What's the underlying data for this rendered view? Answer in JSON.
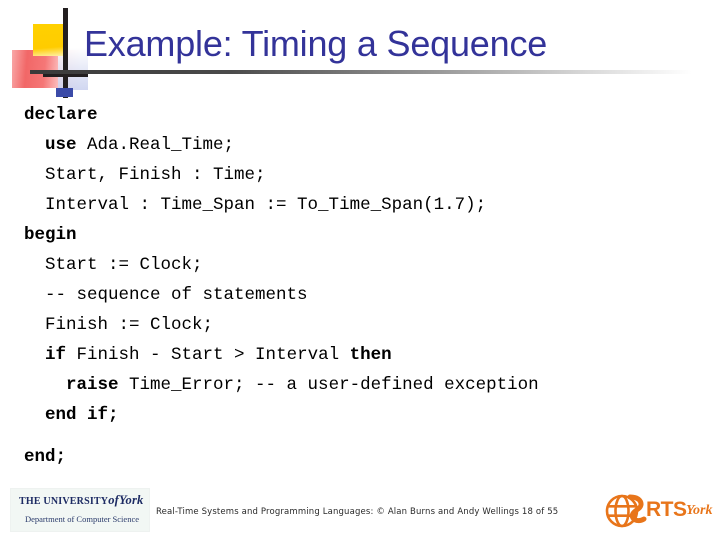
{
  "slide": {
    "title": "Example: Timing a Sequence",
    "title_color": "#333399",
    "background_color": "#ffffff"
  },
  "decoration": {
    "yellow_color": "#FFCC00",
    "red_color": "#F05A5A",
    "blue_color": "#3B4BA8",
    "bar_color": "#231F20"
  },
  "code": {
    "language": "Ada",
    "lines": [
      {
        "indent": 0,
        "spans": [
          {
            "text": "declare",
            "bold": true
          }
        ]
      },
      {
        "indent": 2,
        "spans": [
          {
            "text": "use ",
            "bold": true
          },
          {
            "text": "Ada.Real_Time;",
            "bold": false
          }
        ]
      },
      {
        "indent": 2,
        "spans": [
          {
            "text": "Start, Finish : Time;",
            "bold": false
          }
        ]
      },
      {
        "indent": 2,
        "spans": [
          {
            "text": "Interval : Time_Span := To_Time_Span(1.7);",
            "bold": false
          }
        ]
      },
      {
        "indent": 0,
        "spans": [
          {
            "text": "begin",
            "bold": true
          }
        ]
      },
      {
        "indent": 2,
        "spans": [
          {
            "text": "Start := Clock;",
            "bold": false
          }
        ]
      },
      {
        "indent": 2,
        "spans": [
          {
            "text": "-- sequence of statements",
            "bold": false
          }
        ]
      },
      {
        "indent": 2,
        "spans": [
          {
            "text": "Finish := Clock;",
            "bold": false
          }
        ]
      },
      {
        "indent": 2,
        "spans": [
          {
            "text": "if ",
            "bold": true
          },
          {
            "text": "Finish - Start > Interval ",
            "bold": false
          },
          {
            "text": "then",
            "bold": true
          }
        ]
      },
      {
        "indent": 4,
        "spans": [
          {
            "text": "raise ",
            "bold": true
          },
          {
            "text": "Time_Error; -- a user-defined exception",
            "bold": false
          }
        ]
      },
      {
        "indent": 2,
        "spans": [
          {
            "text": "end if;",
            "bold": true
          }
        ]
      },
      {
        "indent": 0,
        "spaced_above": true,
        "spans": [
          {
            "text": "end;",
            "bold": true
          }
        ]
      }
    ]
  },
  "footer": {
    "credit": "Real-Time Systems and Programming Languages: © Alan Burns and Andy Wellings 18 of 55",
    "university_logo": {
      "line1_prefix": "THE UNIVERSITY",
      "line1_of": "of",
      "line1_name": "York",
      "line2": "Department of Computer Science"
    },
    "rts_logo": {
      "acronym": "RTS",
      "suffix": "York",
      "color": "#E8751A"
    }
  }
}
